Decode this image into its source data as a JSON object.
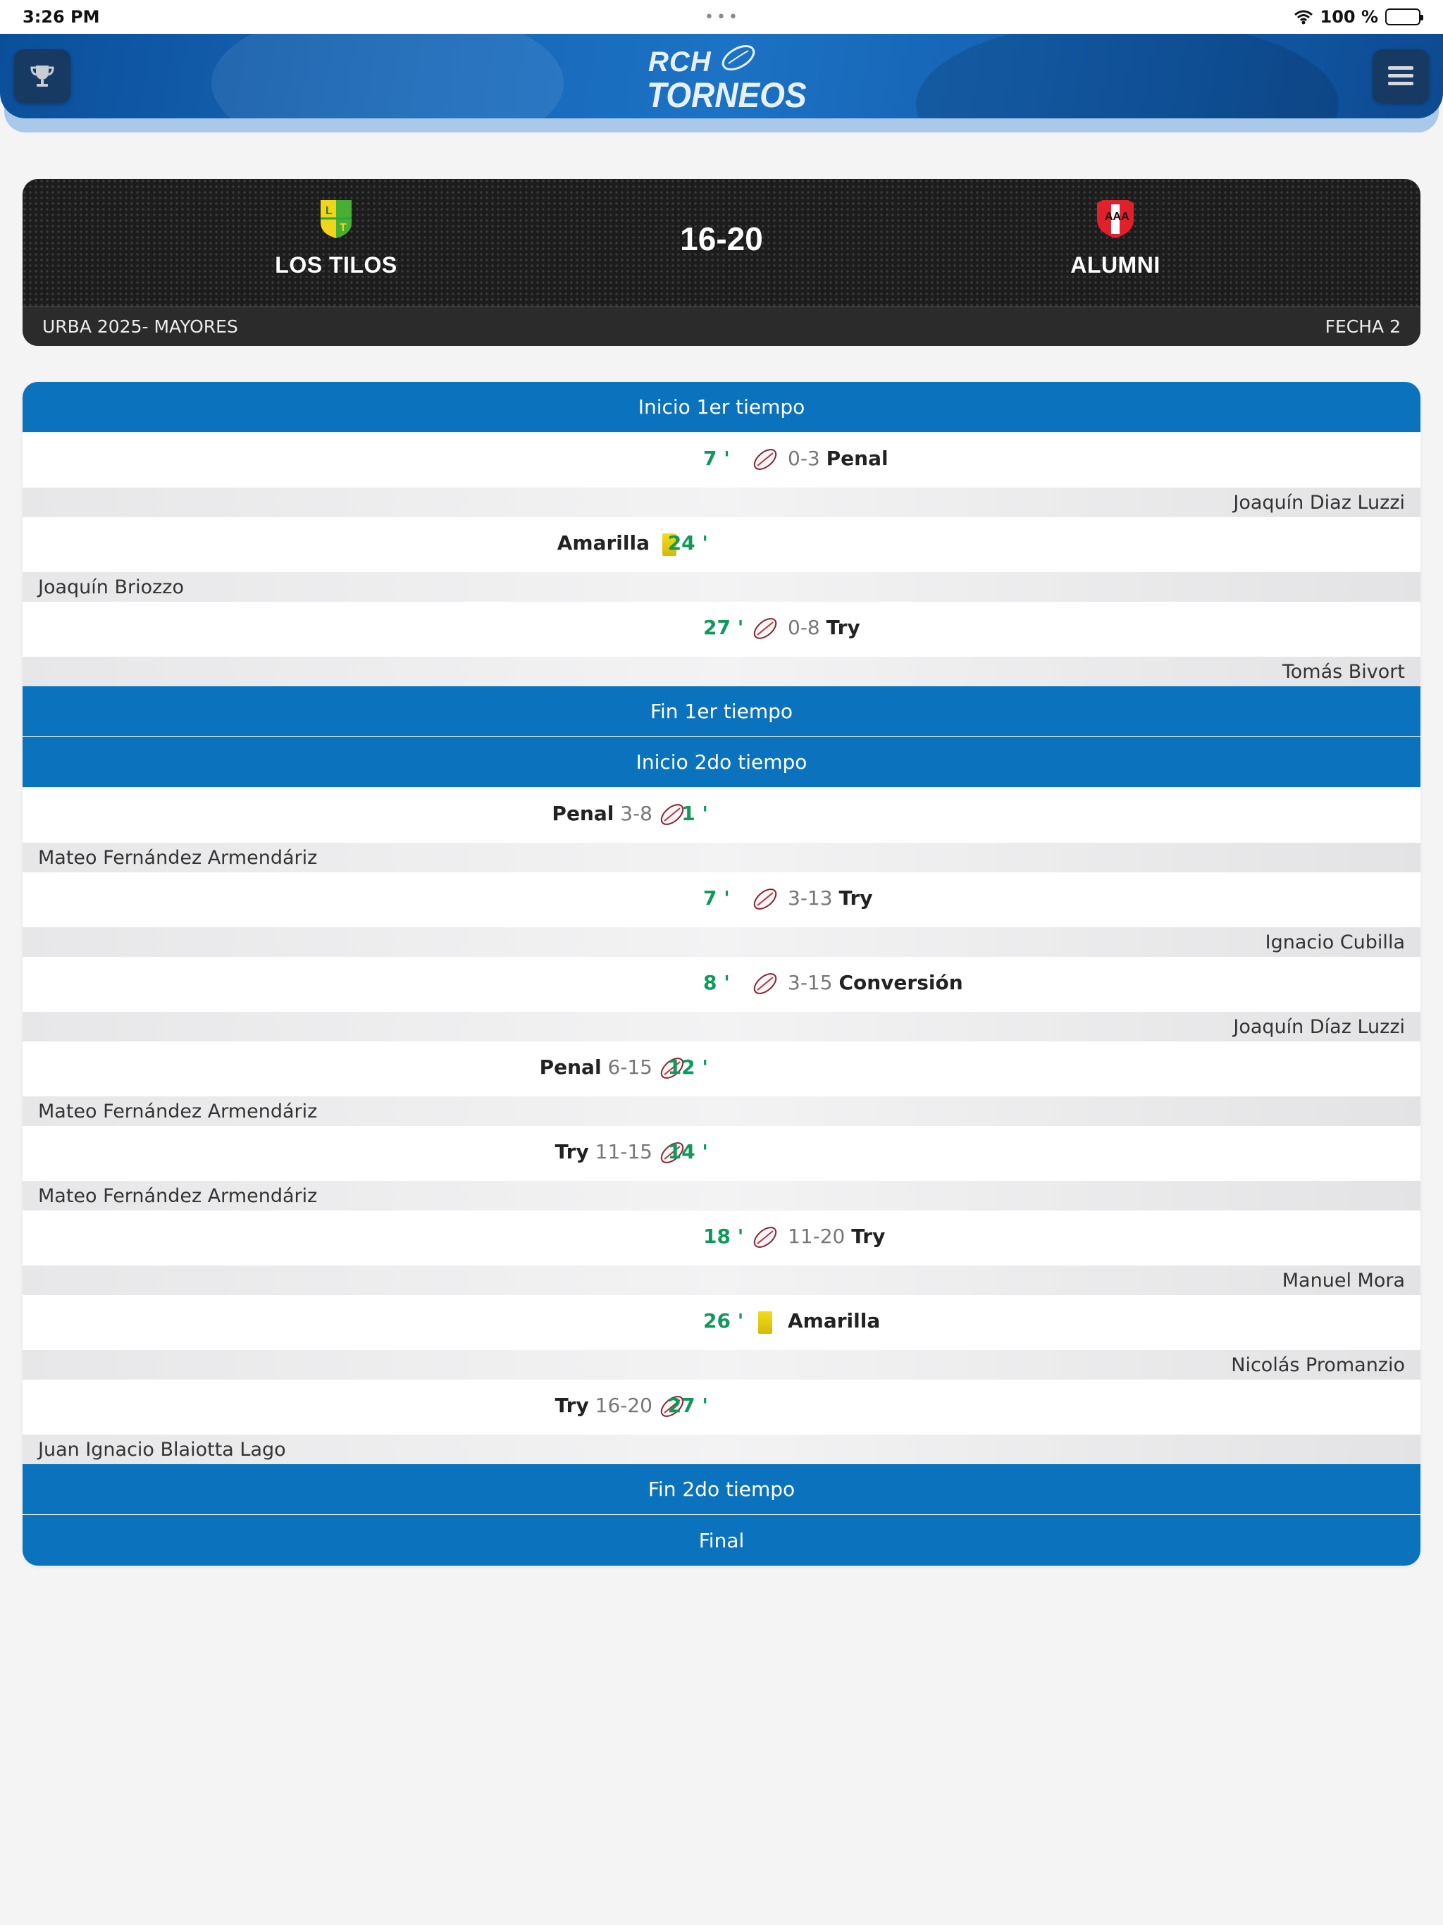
{
  "status_bar": {
    "time": "3:26 PM",
    "battery": "100 %"
  },
  "header": {
    "logo_line1": "RCH",
    "logo_line2": "TORNEOS",
    "left_icon": "trophy-icon",
    "right_icon": "menu-icon"
  },
  "match": {
    "home_team": "LOS TILOS",
    "away_team": "ALUMNI",
    "score": "16-20",
    "tournament": "URBA 2025- MAYORES",
    "round": "FECHA 2",
    "colors": {
      "home_primary": "#f2d51a",
      "home_secondary": "#29a83a",
      "away_primary": "#e0202a"
    }
  },
  "timeline": {
    "phase_start_1": "Inicio 1er tiempo",
    "phase_end_1": "Fin 1er tiempo",
    "phase_start_2": "Inicio 2do tiempo",
    "phase_end_2": "Fin 2do tiempo",
    "phase_final": "Final",
    "events": [
      {
        "minute": "7 '",
        "score": "0-3",
        "type": "Penal",
        "player": "Joaquín Diaz Luzzi",
        "side": "away",
        "icon": "rugby-ball-icon"
      },
      {
        "minute": "24 '",
        "score": "",
        "type": "Amarilla",
        "player": "Joaquín Briozzo",
        "side": "home",
        "icon": "yellow-card-icon"
      },
      {
        "minute": "27 '",
        "score": "0-8",
        "type": "Try",
        "player": "Tomás Bivort",
        "side": "away",
        "icon": "rugby-ball-icon"
      },
      {
        "minute": "1 '",
        "score": "3-8",
        "type": "Penal",
        "player": "Mateo Fernández Armendáriz",
        "side": "home",
        "icon": "rugby-ball-icon"
      },
      {
        "minute": "7 '",
        "score": "3-13",
        "type": "Try",
        "player": "Ignacio Cubilla",
        "side": "away",
        "icon": "rugby-ball-icon"
      },
      {
        "minute": "8 '",
        "score": "3-15",
        "type": "Conversión",
        "player": "Joaquín Díaz Luzzi",
        "side": "away",
        "icon": "rugby-ball-icon"
      },
      {
        "minute": "12 '",
        "score": "6-15",
        "type": "Penal",
        "player": "Mateo Fernández Armendáriz",
        "side": "home",
        "icon": "rugby-ball-icon"
      },
      {
        "minute": "14 '",
        "score": "11-15",
        "type": "Try",
        "player": "Mateo Fernández Armendáriz",
        "side": "home",
        "icon": "rugby-ball-icon"
      },
      {
        "minute": "18 '",
        "score": "11-20",
        "type": "Try",
        "player": "Manuel Mora",
        "side": "away",
        "icon": "rugby-ball-icon"
      },
      {
        "minute": "26 '",
        "score": "",
        "type": "Amarilla",
        "player": "Nicolás Promanzio",
        "side": "away",
        "icon": "yellow-card-icon"
      },
      {
        "minute": "27 '",
        "score": "16-20",
        "type": "Try",
        "player": "Juan Ignacio Blaiotta Lago",
        "side": "home",
        "icon": "rugby-ball-icon"
      }
    ]
  },
  "colors": {
    "accent_blue": "#0b72bd",
    "minute_green": "#0f9a5b"
  }
}
